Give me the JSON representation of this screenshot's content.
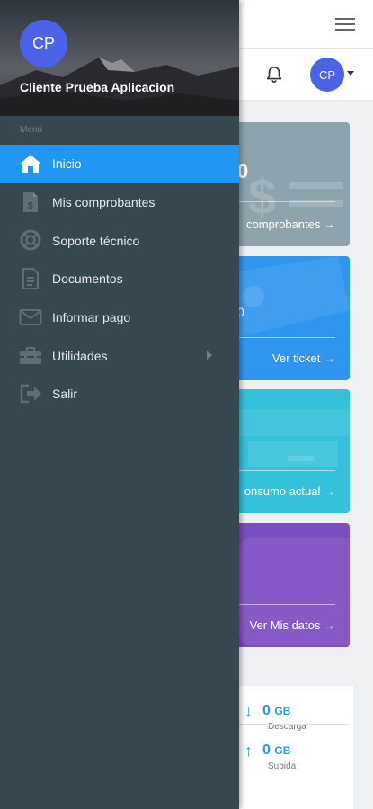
{
  "app": {
    "user_initials": "CP",
    "cards": [
      {
        "value": "0",
        "link": "comprobantes →"
      },
      {
        "value": "0",
        "link": "Ver ticket →"
      },
      {
        "link": "onsumo actual →"
      },
      {
        "link": "Ver Mis datos →"
      }
    ],
    "stats": [
      {
        "arrow": "↓",
        "value": "0",
        "unit": "GB",
        "caption": "Descarga"
      },
      {
        "arrow": "↑",
        "value": "0",
        "unit": "GB",
        "caption": "Subida"
      }
    ]
  },
  "drawer": {
    "avatar_initials": "CP",
    "user_name": "Cliente Prueba Aplicacion",
    "menu_caption": "Menú",
    "items": [
      {
        "label": "Inicio",
        "icon": "home-icon",
        "active": true
      },
      {
        "label": "Mis comprobantes",
        "icon": "invoice-icon"
      },
      {
        "label": "Soporte técnico",
        "icon": "lifebuoy-icon"
      },
      {
        "label": "Documentos",
        "icon": "document-icon"
      },
      {
        "label": "Informar pago",
        "icon": "envelope-icon"
      },
      {
        "label": "Utilidades",
        "icon": "toolbox-icon",
        "has_submenu": true
      },
      {
        "label": "Salir",
        "icon": "logout-icon"
      }
    ]
  },
  "colors": {
    "drawer_bg": "#37474f",
    "active": "#2196f3",
    "avatar": "#4a63e8",
    "card1": "#8fa3ac",
    "card2": "#2f96ef",
    "card3": "#35c1d9",
    "card4": "#7b4dc2",
    "stat_value": "#2a9cc7"
  }
}
